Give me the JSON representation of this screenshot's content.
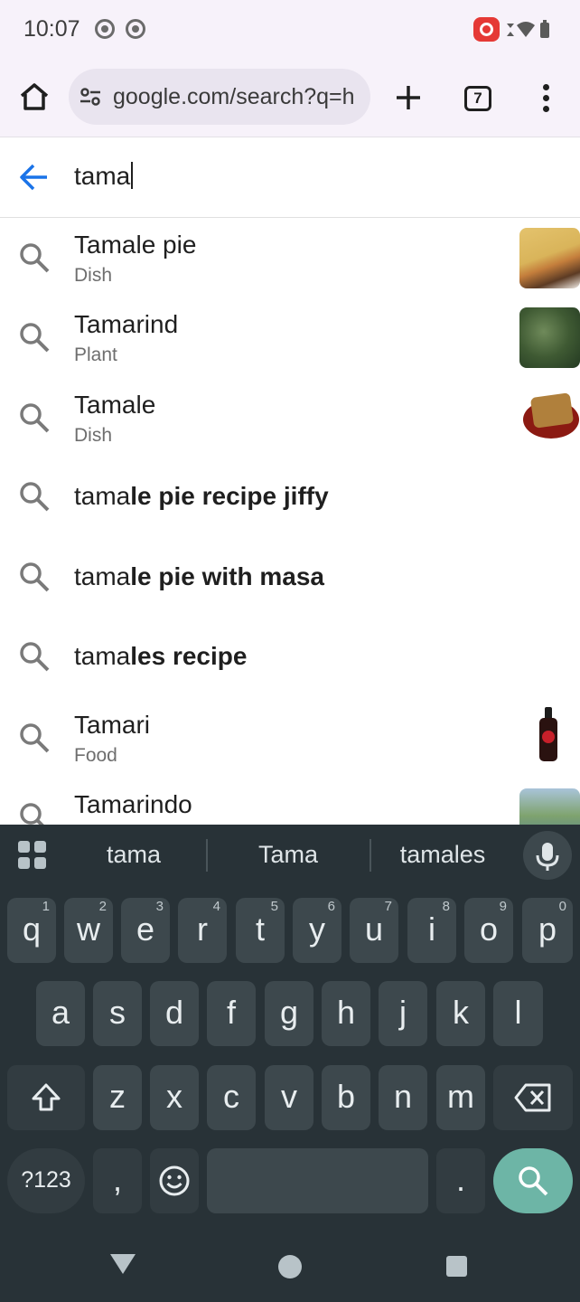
{
  "status_bar": {
    "time": "10:07"
  },
  "toolbar": {
    "url": "google.com/search?q=h",
    "tab_count": "7"
  },
  "search": {
    "query": "tama"
  },
  "suggestions": [
    {
      "title": "Tamale pie",
      "subtitle": "Dish",
      "thumbnail": "tamale-pie-photo"
    },
    {
      "title": "Tamarind",
      "subtitle": "Plant",
      "thumbnail": "tamarind-tree-photo"
    },
    {
      "title": "Tamale",
      "subtitle": "Dish",
      "thumbnail": "tamale-plate-photo"
    },
    {
      "prefix": "tama",
      "rest": "le pie recipe jiffy"
    },
    {
      "prefix": "tama",
      "rest": "le pie with masa"
    },
    {
      "prefix": "tama",
      "rest": "les recipe"
    },
    {
      "title": "Tamari",
      "subtitle": "Food",
      "thumbnail": "tamari-bottle-photo"
    },
    {
      "title": "Tamarindo",
      "subtitle": "",
      "thumbnail": "tamarindo-coast-photo"
    }
  ],
  "keyboard": {
    "word_suggestions": [
      "tama",
      "Tama",
      "tamales"
    ],
    "row1": [
      {
        "k": "q",
        "n": "1"
      },
      {
        "k": "w",
        "n": "2"
      },
      {
        "k": "e",
        "n": "3"
      },
      {
        "k": "r",
        "n": "4"
      },
      {
        "k": "t",
        "n": "5"
      },
      {
        "k": "y",
        "n": "6"
      },
      {
        "k": "u",
        "n": "7"
      },
      {
        "k": "i",
        "n": "8"
      },
      {
        "k": "o",
        "n": "9"
      },
      {
        "k": "p",
        "n": "0"
      }
    ],
    "row2": [
      "a",
      "s",
      "d",
      "f",
      "g",
      "h",
      "j",
      "k",
      "l"
    ],
    "row3": [
      "z",
      "x",
      "c",
      "v",
      "b",
      "n",
      "m"
    ],
    "symbols_label": "?123",
    "comma": ",",
    "period": "."
  },
  "colors": {
    "accent_blue": "#1a73e8",
    "keyboard_bg": "#283237",
    "key_bg": "#3d484d",
    "search_key": "#6db5a6"
  }
}
